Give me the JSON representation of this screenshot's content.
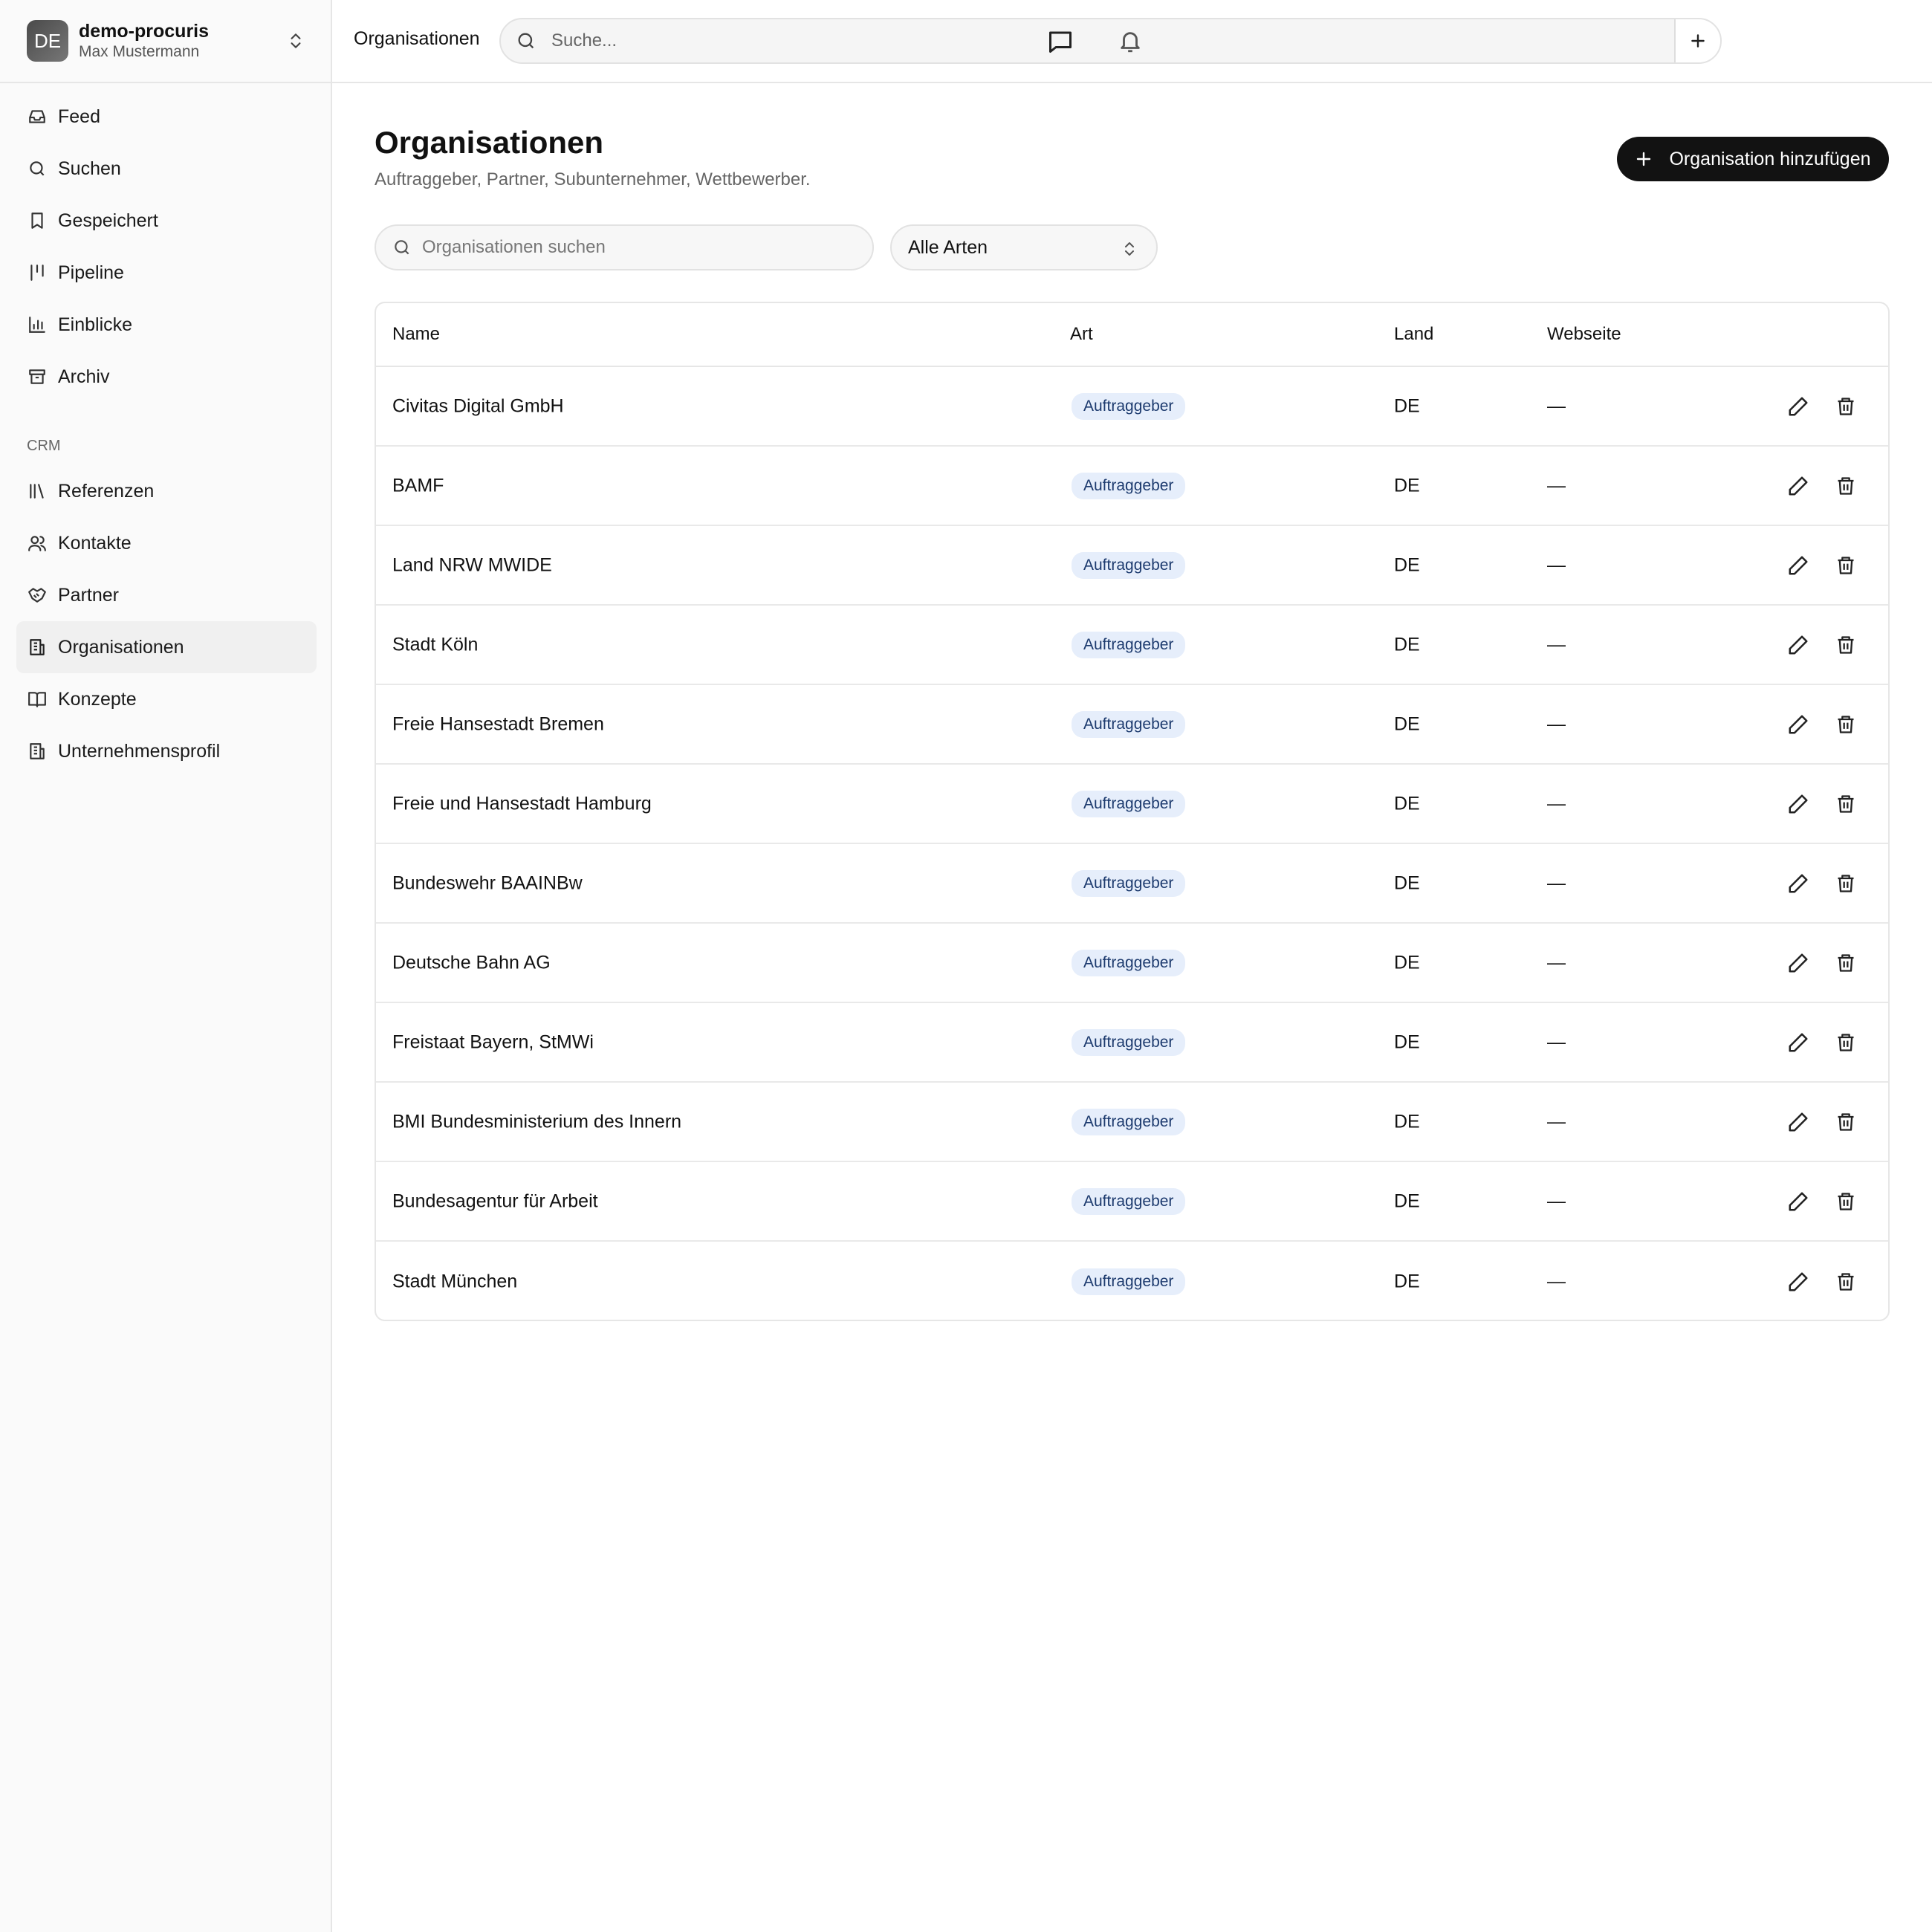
{
  "workspace": {
    "initials": "DE",
    "name": "demo-procuris",
    "user": "Max Mustermann"
  },
  "nav": {
    "main": [
      {
        "label": "Feed",
        "icon": "inbox-icon"
      },
      {
        "label": "Suchen",
        "icon": "search-icon"
      },
      {
        "label": "Gespeichert",
        "icon": "bookmark-icon"
      },
      {
        "label": "Pipeline",
        "icon": "kanban-icon"
      },
      {
        "label": "Einblicke",
        "icon": "bar-chart-icon"
      },
      {
        "label": "Archiv",
        "icon": "archive-icon"
      }
    ],
    "section_label": "CRM",
    "crm": [
      {
        "label": "Referenzen",
        "icon": "library-icon"
      },
      {
        "label": "Kontakte",
        "icon": "users-icon"
      },
      {
        "label": "Partner",
        "icon": "handshake-icon"
      },
      {
        "label": "Organisationen",
        "icon": "building-icon",
        "active": true
      },
      {
        "label": "Konzepte",
        "icon": "book-open-icon"
      },
      {
        "label": "Unternehmensprofil",
        "icon": "building-icon"
      }
    ]
  },
  "topbar": {
    "breadcrumb": "Organisationen",
    "search_placeholder": "Suche..."
  },
  "page": {
    "title": "Organisationen",
    "subtitle": "Auftraggeber, Partner, Subunternehmer, Wettbewerber.",
    "add_button": "Organisation hinzufügen",
    "search_placeholder": "Organisationen suchen",
    "filter_value": "Alle Arten"
  },
  "table": {
    "columns": [
      "Name",
      "Art",
      "Land",
      "Webseite"
    ],
    "rows": [
      {
        "name": "Civitas Digital GmbH",
        "art": "Auftraggeber",
        "land": "DE",
        "web": "—"
      },
      {
        "name": "BAMF",
        "art": "Auftraggeber",
        "land": "DE",
        "web": "—"
      },
      {
        "name": "Land NRW MWIDE",
        "art": "Auftraggeber",
        "land": "DE",
        "web": "—"
      },
      {
        "name": "Stadt Köln",
        "art": "Auftraggeber",
        "land": "DE",
        "web": "—"
      },
      {
        "name": "Freie Hansestadt Bremen",
        "art": "Auftraggeber",
        "land": "DE",
        "web": "—"
      },
      {
        "name": "Freie und Hansestadt Hamburg",
        "art": "Auftraggeber",
        "land": "DE",
        "web": "—"
      },
      {
        "name": "Bundeswehr BAAINBw",
        "art": "Auftraggeber",
        "land": "DE",
        "web": "—"
      },
      {
        "name": "Deutsche Bahn AG",
        "art": "Auftraggeber",
        "land": "DE",
        "web": "—"
      },
      {
        "name": "Freistaat Bayern, StMWi",
        "art": "Auftraggeber",
        "land": "DE",
        "web": "—"
      },
      {
        "name": "BMI Bundesministerium des Innern",
        "art": "Auftraggeber",
        "land": "DE",
        "web": "—"
      },
      {
        "name": "Bundesagentur für Arbeit",
        "art": "Auftraggeber",
        "land": "DE",
        "web": "—"
      },
      {
        "name": "Stadt München",
        "art": "Auftraggeber",
        "land": "DE",
        "web": "—"
      }
    ]
  },
  "colors": {
    "primary_button": "#121212",
    "badge_bg": "#e6eefb",
    "badge_text": "#1c3a6e"
  }
}
